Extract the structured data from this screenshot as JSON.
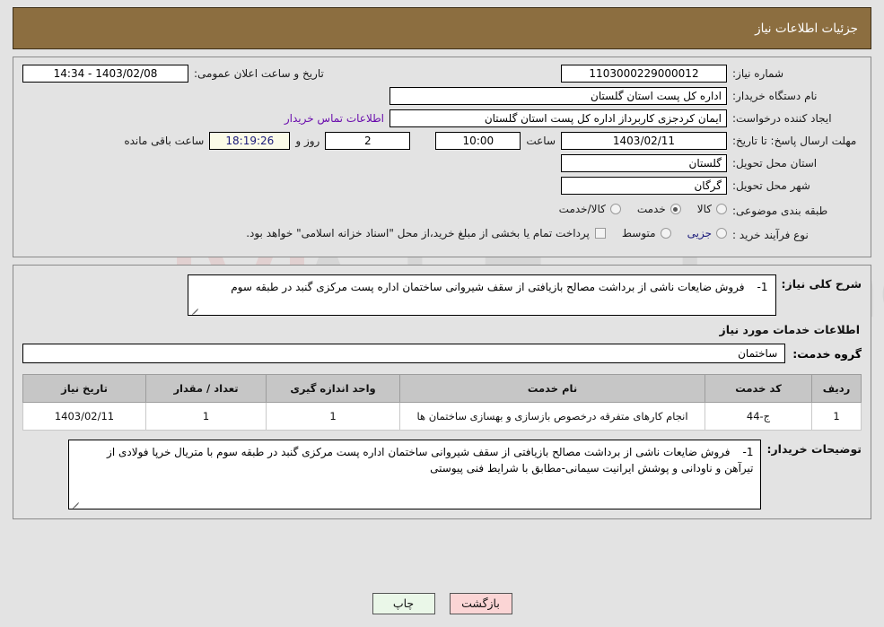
{
  "header": {
    "title": "جزئیات اطلاعات نیاز"
  },
  "form": {
    "need_number_label": "شماره نیاز:",
    "need_number_value": "1103000229000012",
    "announce_label": "تاریخ و ساعت اعلان عمومی:",
    "announce_value": "1403/02/08 - 14:34",
    "buyer_org_label": "نام دستگاه خریدار:",
    "buyer_org_value": "اداره کل پست استان گلستان",
    "creator_label": "ایجاد کننده درخواست:",
    "creator_value": "ایمان کردجزی کاربرداز اداره کل پست استان گلستان",
    "contact_link": "اطلاعات تماس خریدار",
    "deadline_label": "مهلت ارسال پاسخ: تا تاریخ:",
    "deadline_date": "1403/02/11",
    "hour_label": "ساعت",
    "hour_value": "10:00",
    "days_value": "2",
    "days_label": "روز و",
    "countdown_value": "18:19:26",
    "countdown_label": "ساعت باقی مانده",
    "province_label": "استان محل تحویل:",
    "province_value": "گلستان",
    "city_label": "شهر محل تحویل:",
    "city_value": "گرگان",
    "category_label": "طبقه بندی موضوعی:",
    "category_options": [
      {
        "label": "کالا",
        "selected": false
      },
      {
        "label": "خدمت",
        "selected": true
      },
      {
        "label": "کالا/خدمت",
        "selected": false
      }
    ],
    "process_label": "نوع فرآیند خرید :",
    "process_options": [
      {
        "label": "جزیی",
        "selected": false
      },
      {
        "label": "متوسط",
        "selected": false
      }
    ],
    "treasury_note": "پرداخت تمام یا بخشی از مبلغ خرید،از محل \"اسناد خزانه اسلامی\" خواهد بود.",
    "treasury_checked": false
  },
  "description": {
    "label": "شرح کلی نیاز:",
    "item_number": "1-",
    "text": "فروش ضایعات ناشی از برداشت مصالح بازیافتی از سقف شیروانی ساختمان اداره پست مرکزی گنبد در طبقه سوم"
  },
  "services_section": {
    "heading": "اطلاعات خدمات مورد نیاز",
    "group_label": "گروه خدمت:",
    "group_value": "ساختمان"
  },
  "table": {
    "columns": [
      "ردیف",
      "کد خدمت",
      "نام خدمت",
      "واحد اندازه گیری",
      "تعداد / مقدار",
      "تاریخ نیاز"
    ],
    "rows": [
      {
        "row_no": "1",
        "service_code": "ج-44",
        "service_name": "انجام کارهای متفرقه درخصوص بازسازی و بهسازی ساختمان ها",
        "unit": "1",
        "quantity": "1",
        "need_date": "1403/02/11"
      }
    ]
  },
  "buyer_notes": {
    "label": "توضیحات خریدار:",
    "item_number": "1-",
    "text": "فروش ضایعات ناشی از برداشت مصالح بازیافتی از سقف شیروانی ساختمان اداره پست مرکزی گنبد در طبقه سوم با متریال خرپا فولادی از تیرآهن و ناودانی و پوشش ایرانیت سیمانی-مطابق با شرایط فنی پیوستی"
  },
  "buttons": {
    "print": "چاپ",
    "back": "بازگشت"
  },
  "watermark": {
    "text": "AriaTender.net"
  },
  "colors": {
    "header_bg": "#8c6e40",
    "page_bg": "#e3e3e3",
    "link": "#6a0dad",
    "countdown_bg": "#fbfbe8",
    "countdown_text": "#1a1a7a",
    "table_header_bg": "#c6c6c6",
    "print_btn_bg": "#eaf7e8",
    "back_btn_bg": "#fbd5d5"
  }
}
